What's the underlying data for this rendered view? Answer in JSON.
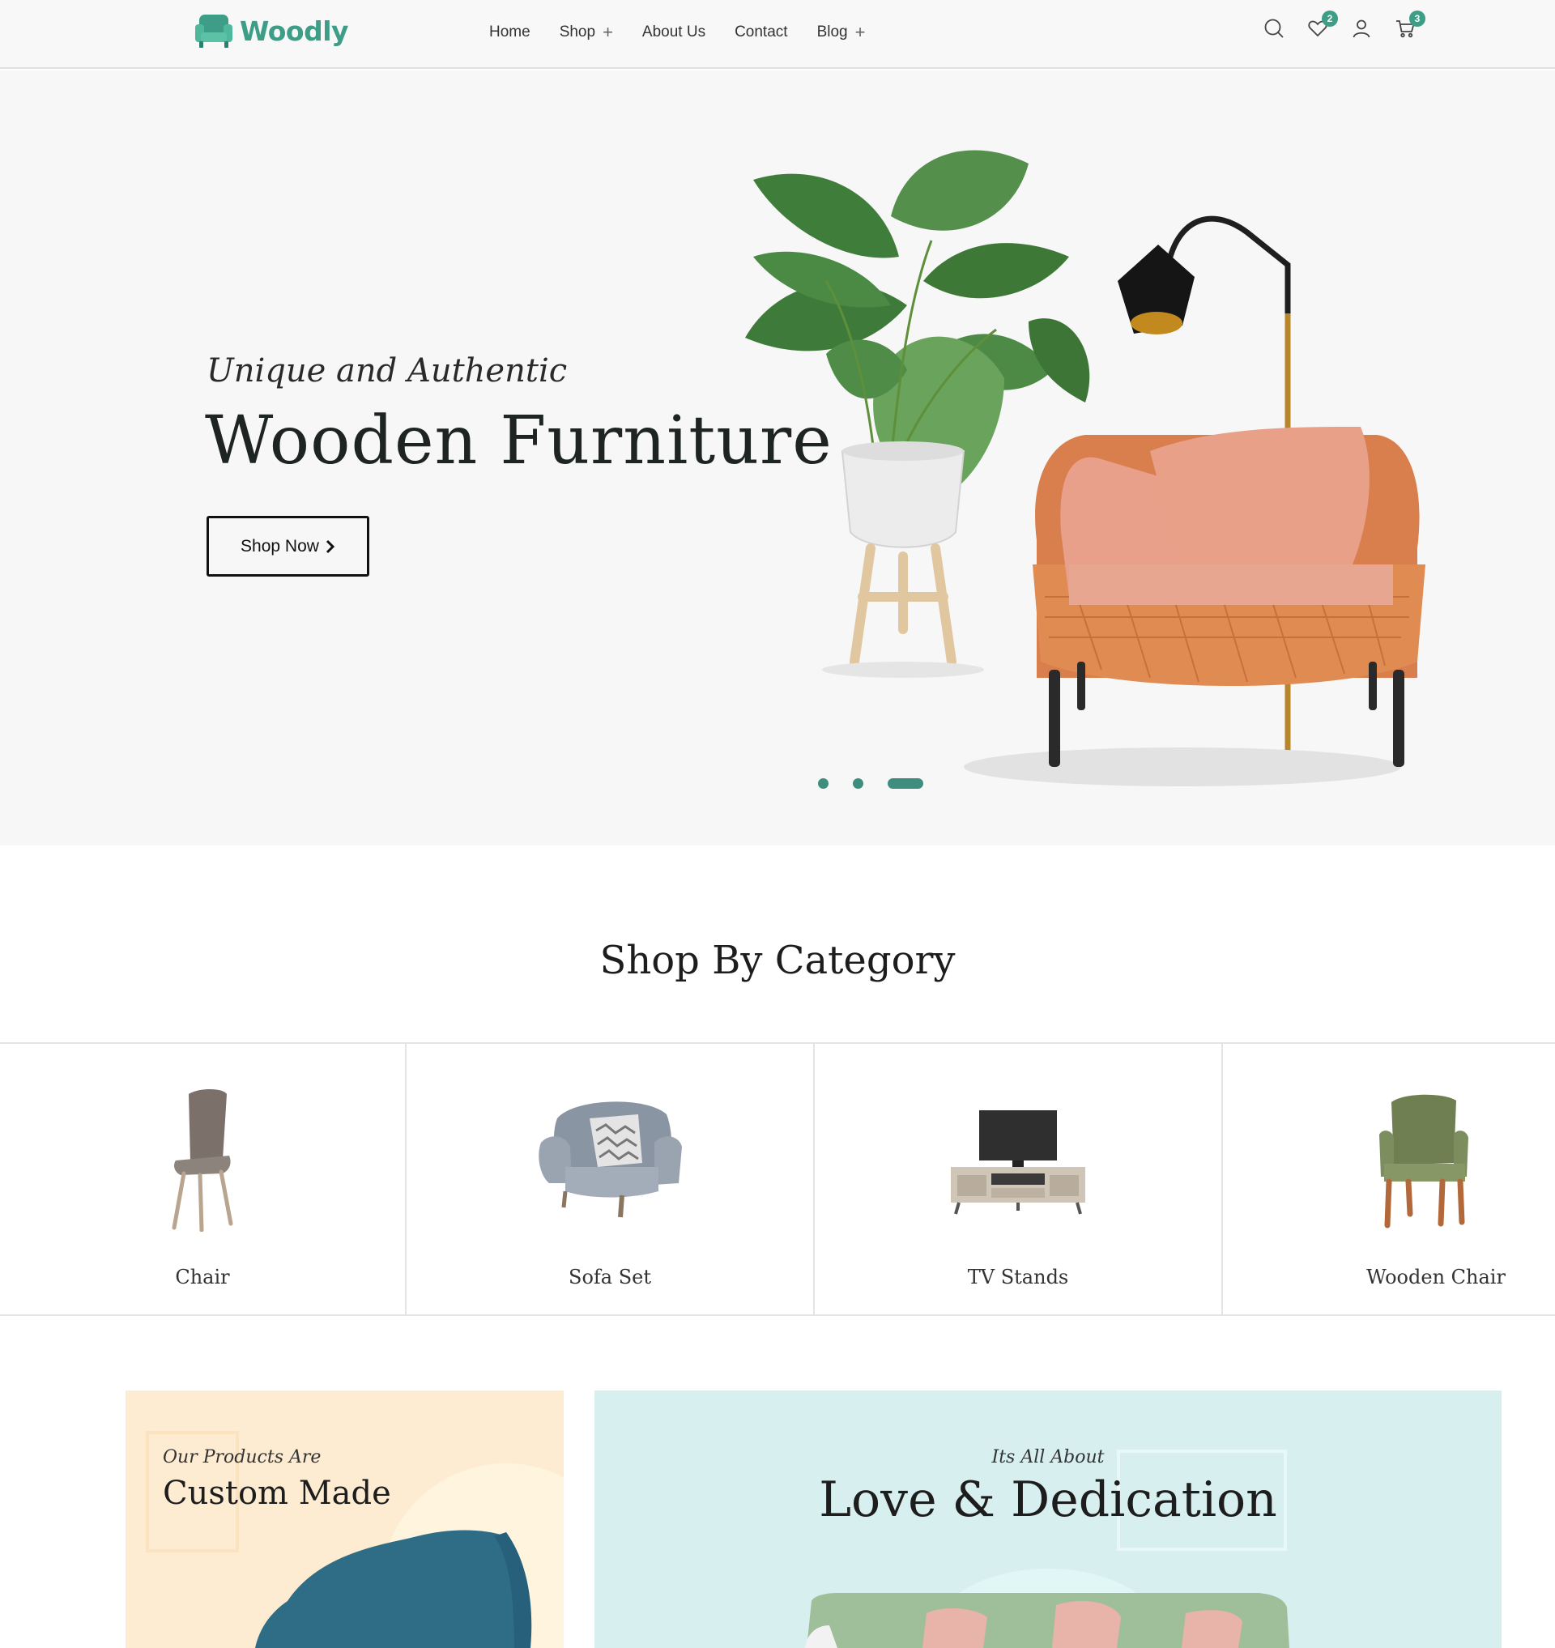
{
  "brand": {
    "name": "Woodly",
    "color": "#3d9d86"
  },
  "nav": {
    "items": [
      {
        "label": "Home",
        "has_submenu": false
      },
      {
        "label": "Shop",
        "has_submenu": true
      },
      {
        "label": "About Us",
        "has_submenu": false
      },
      {
        "label": "Contact",
        "has_submenu": false
      },
      {
        "label": "Blog",
        "has_submenu": true
      }
    ],
    "submenu_glyph": "+"
  },
  "header_icons": {
    "search": {
      "icon": "search-icon"
    },
    "wishlist": {
      "icon": "heart-icon",
      "count": "2"
    },
    "account": {
      "icon": "user-icon"
    },
    "cart": {
      "icon": "cart-icon",
      "count": "3"
    }
  },
  "hero": {
    "subtitle": "Unique and Authentic",
    "title": "Wooden Furniture",
    "cta_label": "Shop Now",
    "cta_icon": "chevron-right-icon",
    "slides_total": 3,
    "active_slide": 3
  },
  "categories": {
    "title": "Shop By Category",
    "items": [
      {
        "label": "Chair",
        "icon": "chair-image"
      },
      {
        "label": "Sofa Set",
        "icon": "sofa-image"
      },
      {
        "label": "TV Stands",
        "icon": "tv-stand-image"
      },
      {
        "label": "Wooden Chair",
        "icon": "wooden-chair-image"
      }
    ]
  },
  "promos": [
    {
      "subtitle": "Our Products Are",
      "title": "Custom Made",
      "background": "#fdebd2"
    },
    {
      "subtitle": "Its All About",
      "title": "Love & Dedication",
      "background": "#d8eff0"
    }
  ],
  "colors": {
    "accent": "#3d9d86",
    "hero_bg": "#f7f7f7",
    "text": "#1d1d1d"
  }
}
